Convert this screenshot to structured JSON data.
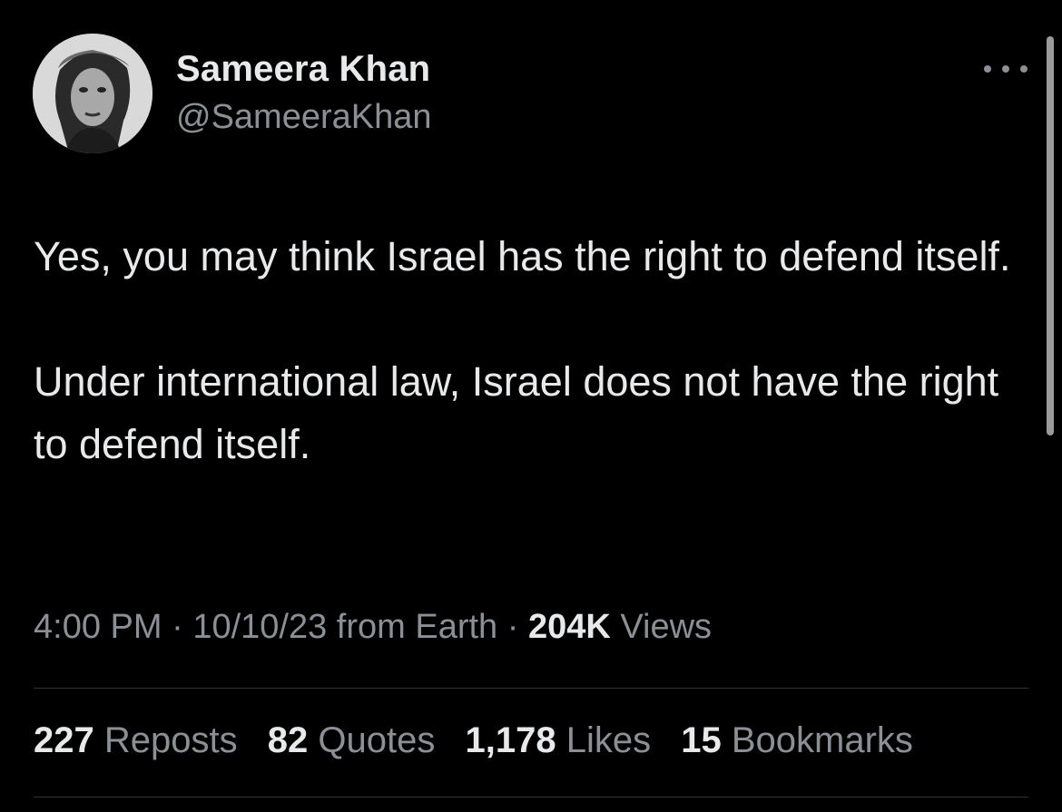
{
  "author": {
    "display_name": "Sameera Khan",
    "handle": "@SameeraKhan",
    "avatar_icon": "profile-photo"
  },
  "more_icon": "more-horizontal-icon",
  "tweet": {
    "paragraphs": [
      "Yes, you may think Israel has the right to defend itself.",
      "Under international law, Israel does not have the right to defend itself."
    ]
  },
  "meta": {
    "time": "4:00 PM",
    "date": "10/10/23",
    "source": "from Earth",
    "views_count": "204K",
    "views_label": "Views",
    "separator": "·"
  },
  "stats": {
    "reposts": {
      "count": "227",
      "label": "Reposts"
    },
    "quotes": {
      "count": "82",
      "label": "Quotes"
    },
    "likes": {
      "count": "1,178",
      "label": "Likes"
    },
    "bookmarks": {
      "count": "15",
      "label": "Bookmarks"
    }
  },
  "colors": {
    "background": "#000000",
    "primary_text": "#e7e9ea",
    "secondary_text": "#8b9096",
    "divider": "#2f3336"
  }
}
